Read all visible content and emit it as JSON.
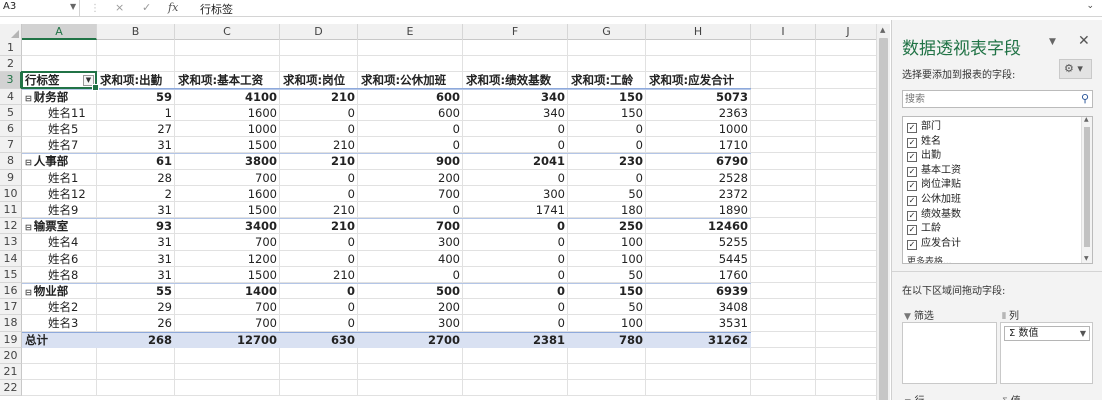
{
  "formula_bar": {
    "name_box": "A3",
    "cancel_icon": "×",
    "confirm_icon": "✓",
    "fx": "fx",
    "content": "行标签"
  },
  "columns": [
    "A",
    "B",
    "C",
    "D",
    "E",
    "F",
    "G",
    "H",
    "I",
    "J"
  ],
  "rows": [
    "1",
    "2",
    "3",
    "4",
    "5",
    "6",
    "7",
    "8",
    "9",
    "10",
    "11",
    "12",
    "13",
    "14",
    "15",
    "16",
    "17",
    "18",
    "19",
    "20",
    "21",
    "22"
  ],
  "pivot": {
    "headers": [
      "行标签",
      "求和项:出勤",
      "求和项:基本工资",
      "求和项:岗位",
      "求和项:公休加班",
      "求和项:绩效基数",
      "求和项:工龄",
      "求和项:应发合计"
    ],
    "body": [
      {
        "type": "dept",
        "label": "财务部",
        "values": [
          "59",
          "4100",
          "210",
          "600",
          "340",
          "150",
          "5073"
        ]
      },
      {
        "type": "item",
        "label": "姓名11",
        "values": [
          "1",
          "1600",
          "0",
          "600",
          "340",
          "150",
          "2363"
        ]
      },
      {
        "type": "item",
        "label": "姓名5",
        "values": [
          "27",
          "1000",
          "0",
          "0",
          "0",
          "0",
          "1000"
        ]
      },
      {
        "type": "item",
        "label": "姓名7",
        "values": [
          "31",
          "1500",
          "210",
          "0",
          "0",
          "0",
          "1710"
        ]
      },
      {
        "type": "dept",
        "label": "人事部",
        "values": [
          "61",
          "3800",
          "210",
          "900",
          "2041",
          "230",
          "6790"
        ]
      },
      {
        "type": "item",
        "label": "姓名1",
        "values": [
          "28",
          "700",
          "0",
          "200",
          "0",
          "0",
          "2528"
        ]
      },
      {
        "type": "item",
        "label": "姓名12",
        "values": [
          "2",
          "1600",
          "0",
          "700",
          "300",
          "50",
          "2372"
        ]
      },
      {
        "type": "item",
        "label": "姓名9",
        "values": [
          "31",
          "1500",
          "210",
          "0",
          "1741",
          "180",
          "1890"
        ]
      },
      {
        "type": "dept",
        "label": "输票室",
        "values": [
          "93",
          "3400",
          "210",
          "700",
          "0",
          "250",
          "12460"
        ]
      },
      {
        "type": "item",
        "label": "姓名4",
        "values": [
          "31",
          "700",
          "0",
          "300",
          "0",
          "100",
          "5255"
        ]
      },
      {
        "type": "item",
        "label": "姓名6",
        "values": [
          "31",
          "1200",
          "0",
          "400",
          "0",
          "100",
          "5445"
        ]
      },
      {
        "type": "item",
        "label": "姓名8",
        "values": [
          "31",
          "1500",
          "210",
          "0",
          "0",
          "50",
          "1760"
        ]
      },
      {
        "type": "dept",
        "label": "物业部",
        "values": [
          "55",
          "1400",
          "0",
          "500",
          "0",
          "150",
          "6939"
        ]
      },
      {
        "type": "item",
        "label": "姓名2",
        "values": [
          "29",
          "700",
          "0",
          "200",
          "0",
          "50",
          "3408"
        ]
      },
      {
        "type": "item",
        "label": "姓名3",
        "values": [
          "26",
          "700",
          "0",
          "300",
          "0",
          "100",
          "3531"
        ]
      }
    ],
    "total": {
      "label": "总计",
      "values": [
        "268",
        "12700",
        "630",
        "2700",
        "2381",
        "780",
        "31262"
      ]
    }
  },
  "field_pane": {
    "title": "数据透视表字段",
    "subtitle": "选择要添加到报表的字段:",
    "search_placeholder": "搜索",
    "fields": [
      "部门",
      "姓名",
      "出勤",
      "基本工资",
      "岗位津贴",
      "公休加班",
      "绩效基数",
      "工龄",
      "应发合计"
    ],
    "more_tables": "更多表格...",
    "drag_hint": "在以下区域间拖动字段:",
    "areas": {
      "filters": "筛选",
      "columns": "列",
      "rows": "行",
      "values": "值",
      "columns_chip": "数值"
    }
  },
  "icons": {
    "search": "search-icon",
    "gear": "gear-icon",
    "close": "close-icon",
    "collapse": "minus-box-icon"
  },
  "colors": {
    "accent": "#217346",
    "pivot_total_bg": "#d9e1f2"
  }
}
